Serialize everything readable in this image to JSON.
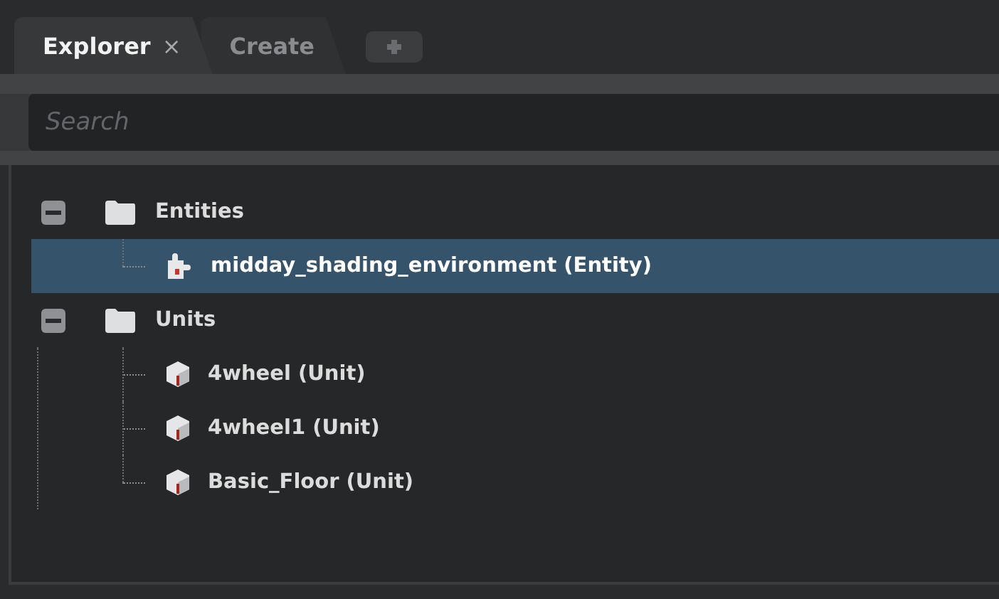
{
  "tabs": [
    {
      "label": "Explorer",
      "close": "×",
      "selected": true
    },
    {
      "label": "Create",
      "selected": false
    }
  ],
  "search": {
    "placeholder": "Search"
  },
  "tree": [
    {
      "label": "Entities",
      "kind": "folder",
      "expanded": true,
      "selected": false,
      "children": [
        {
          "label": "midday_shading_environment (Entity)",
          "kind": "entity",
          "selected": true
        }
      ]
    },
    {
      "label": "Units",
      "kind": "folder",
      "expanded": true,
      "selected": false,
      "children": [
        {
          "label": "4wheel (Unit)",
          "kind": "unit",
          "selected": false
        },
        {
          "label": "4wheel1 (Unit)",
          "kind": "unit",
          "selected": false
        },
        {
          "label": "Basic_Floor (Unit)",
          "kind": "unit",
          "selected": false
        }
      ]
    }
  ]
}
